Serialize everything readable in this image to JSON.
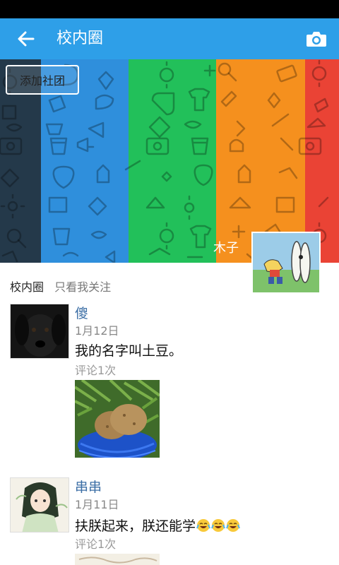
{
  "header": {
    "title": "校内圈",
    "back_icon": "arrow-left-icon",
    "camera_icon": "camera-icon"
  },
  "banner": {
    "add_club_label": "添加社团",
    "user_name": "木子",
    "stripe_colors": [
      "#24394a",
      "#2f8fdc",
      "#22c05a",
      "#f5901e",
      "#ea4335"
    ]
  },
  "filters": {
    "school_label": "校内圈",
    "follow_label": "只看我关注"
  },
  "posts": [
    {
      "author": "傻",
      "date": "1月12日",
      "text": "我的名字叫土豆。",
      "comments": "评论1次"
    },
    {
      "author": "串串",
      "date": "1月11日",
      "text": "扶朕起来，朕还能学",
      "emojis": [
        "😂",
        "😂",
        "😂"
      ],
      "comments": "评论1次"
    }
  ]
}
